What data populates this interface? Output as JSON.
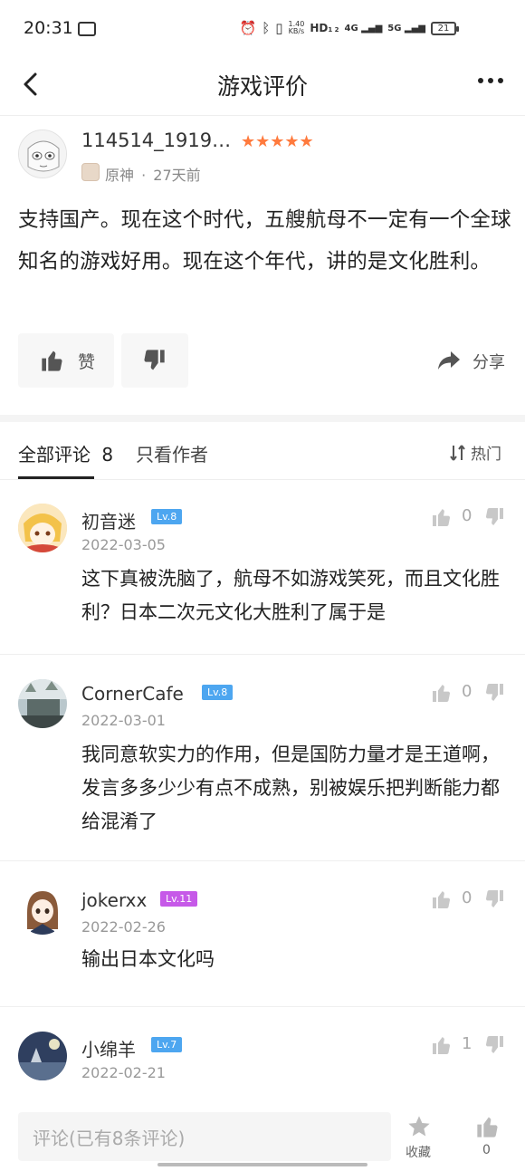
{
  "status_bar": {
    "time": "20:31",
    "net_speed_value": "1.40",
    "net_speed_unit": "KB/s",
    "hd": "HD",
    "hd_sub": "1 2",
    "sig1": "4G",
    "sig2": "5G",
    "battery": "21"
  },
  "header": {
    "title": "游戏评价"
  },
  "review": {
    "username": "114514_1919…",
    "stars": "★★★★★",
    "game": "原神",
    "time_ago": "27天前",
    "meta_sep": "·",
    "body": "支持国产。现在这个时代，五艘航母不一定有一个全球知名的游戏好用。现在这个年代，讲的是文化胜利。",
    "like_label": "赞",
    "share_label": "分享"
  },
  "tabs": {
    "all": "全部评论",
    "all_count": "8",
    "author_only": "只看作者",
    "sort": "热门"
  },
  "comments": [
    {
      "name": "初音迷",
      "level": "Lv.8",
      "level_color": "#4da6f0",
      "date": "2022-03-05",
      "text": "这下真被洗脑了，航母不如游戏笑死，而且文化胜利？日本二次元文化大胜利了属于是",
      "likes": "0"
    },
    {
      "name": "CornerCafe",
      "level": "Lv.8",
      "level_color": "#4da6f0",
      "date": "2022-03-01",
      "text": "我同意软实力的作用，但是国防力量才是王道啊，发言多多少少有点不成熟，别被娱乐把判断能力都给混淆了",
      "likes": "0"
    },
    {
      "name": "jokerxx",
      "level": "Lv.11",
      "level_color": "#c659e8",
      "date": "2022-02-26",
      "text": "输出日本文化吗",
      "likes": "0"
    },
    {
      "name": "小绵羊",
      "level": "Lv.7",
      "level_color": "#4da6f0",
      "date": "2022-02-21",
      "text": "",
      "likes": "1"
    }
  ],
  "bottom_bar": {
    "placeholder": "评论(已有8条评论)",
    "favorite": "收藏",
    "like_count": "0"
  },
  "colors": {
    "star": "#ff7a3d",
    "accent_dark": "#222222",
    "muted": "#999999"
  }
}
